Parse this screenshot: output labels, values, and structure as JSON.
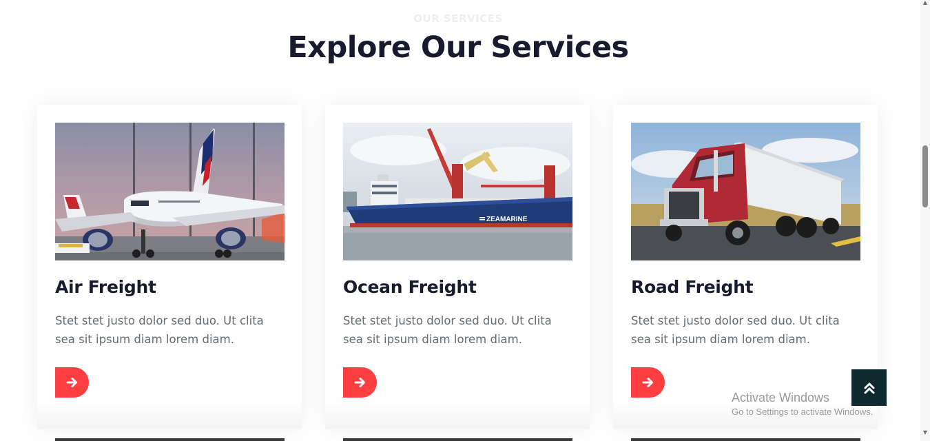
{
  "section": {
    "eyebrow": "OUR SERVICES",
    "title": "Explore Our Services"
  },
  "services": [
    {
      "title": "Air Freight",
      "description": "Stet stet justo dolor sed duo. Ut clita sea sit ipsum diam lorem diam.",
      "image": "airplane-photo",
      "button_icon": "arrow-right-icon"
    },
    {
      "title": "Ocean Freight",
      "description": "Stet stet justo dolor sed duo. Ut clita sea sit ipsum diam lorem diam.",
      "image": "cargo-ship-photo",
      "ship_name": "ZEAMARINE",
      "button_icon": "arrow-right-icon"
    },
    {
      "title": "Road Freight",
      "description": "Stet stet justo dolor sed duo. Ut clita sea sit ipsum diam lorem diam.",
      "image": "truck-photo",
      "button_icon": "arrow-right-icon"
    }
  ],
  "back_to_top": {
    "icon": "double-chevron-up-icon"
  },
  "windows_watermark": {
    "title": "Activate Windows",
    "subtitle": "Go to Settings to activate Windows."
  },
  "colors": {
    "accent": "#ff3e41",
    "heading": "#1a1a2e",
    "body_text": "#666b73",
    "back_to_top_bg": "#0e2a2f"
  }
}
